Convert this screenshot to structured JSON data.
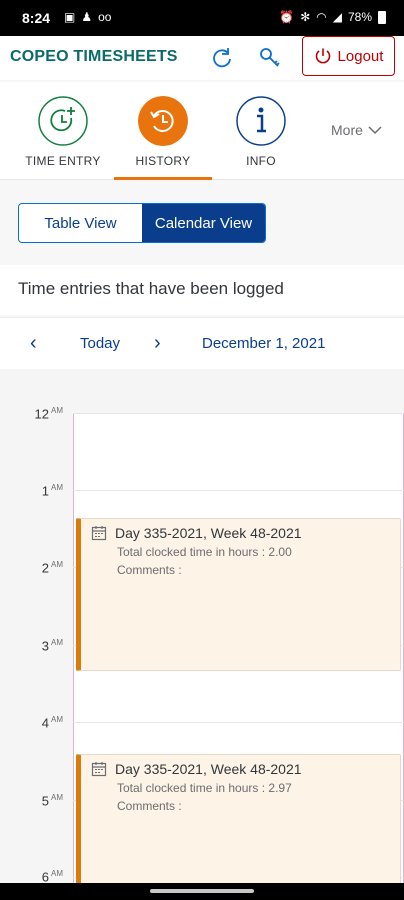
{
  "status": {
    "time": "8:24",
    "battery": "78%"
  },
  "header": {
    "title": "COPEO TIMESHEETS",
    "logout_label": "Logout"
  },
  "nav": {
    "tabs": [
      {
        "label": "TIME ENTRY",
        "icon": "clock-add-icon"
      },
      {
        "label": "HISTORY",
        "icon": "history-icon"
      },
      {
        "label": "INFO",
        "icon": "info-icon"
      }
    ],
    "active": "HISTORY",
    "more_label": "More"
  },
  "views": {
    "table": "Table View",
    "calendar": "Calendar View",
    "selected": "Calendar View"
  },
  "subtitle": "Time entries that have been logged",
  "calendar": {
    "today_label": "Today",
    "date": "December 1, 2021",
    "hours": [
      {
        "h": "12",
        "ap": "AM"
      },
      {
        "h": "1",
        "ap": "AM"
      },
      {
        "h": "2",
        "ap": "AM"
      },
      {
        "h": "3",
        "ap": "AM"
      },
      {
        "h": "4",
        "ap": "AM"
      },
      {
        "h": "5",
        "ap": "AM"
      },
      {
        "h": "6",
        "ap": "AM"
      }
    ],
    "appointments": [
      {
        "title": "Day 335-2021, Week 48-2021",
        "total": "Total clocked time in hours : 2.00",
        "comments": "Comments :"
      },
      {
        "title": "Day 335-2021, Week 48-2021",
        "total": "Total clocked time in hours : 2.97",
        "comments": "Comments :"
      }
    ]
  },
  "colors": {
    "accent": "#e9730c",
    "brand": "#0a6b6a",
    "primary": "#0a3e8c",
    "danger": "#bb0000"
  }
}
